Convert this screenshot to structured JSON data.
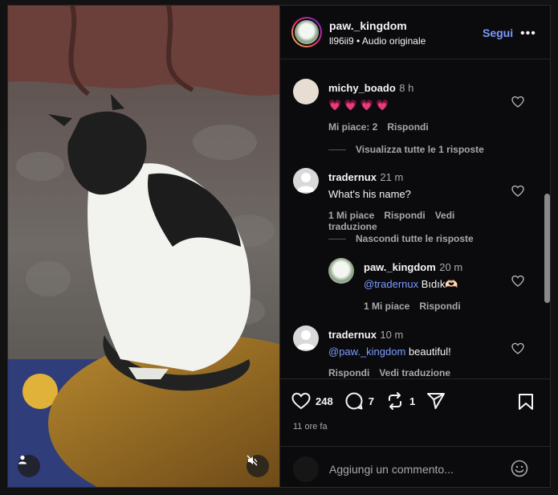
{
  "header": {
    "username": "paw._kingdom",
    "subtitle": "ll96ii9 • Audio originale",
    "follow_label": "Segui",
    "more_label": "•••"
  },
  "comments": [
    {
      "username": "michy_boado",
      "time": "8 h",
      "text": "💗 💗 💗 💗",
      "likes": "Mi piace: 2",
      "reply": "Rispondi",
      "view_replies": "Visualizza tutte le 1 risposte"
    },
    {
      "username": "tradernux",
      "time": "21 m",
      "text": "What's his name?",
      "likes": "1 Mi piace",
      "reply": "Rispondi",
      "translate": "Vedi traduzione",
      "hide_replies": "Nascondi tutte le risposte",
      "replies": [
        {
          "username": "paw._kingdom",
          "time": "20 m",
          "mention": "@tradernux",
          "text": "Bıdık🫶🏻",
          "likes": "1 Mi piace",
          "reply": "Rispondi"
        }
      ]
    },
    {
      "username": "tradernux",
      "time": "10 m",
      "mention": "@paw._kingdom",
      "text": "beautiful!",
      "reply": "Rispondi",
      "translate": "Vedi traduzione"
    }
  ],
  "actions": {
    "likes": "248",
    "comments": "7",
    "reposts": "1",
    "time_ago": "11 ore fa"
  },
  "add_comment": {
    "placeholder": "Aggiungi un commento..."
  },
  "icons": [
    "heart-icon",
    "comment-icon",
    "repost-icon",
    "share-icon",
    "bookmark-icon",
    "emoji-icon",
    "user-icon",
    "mute-icon"
  ]
}
